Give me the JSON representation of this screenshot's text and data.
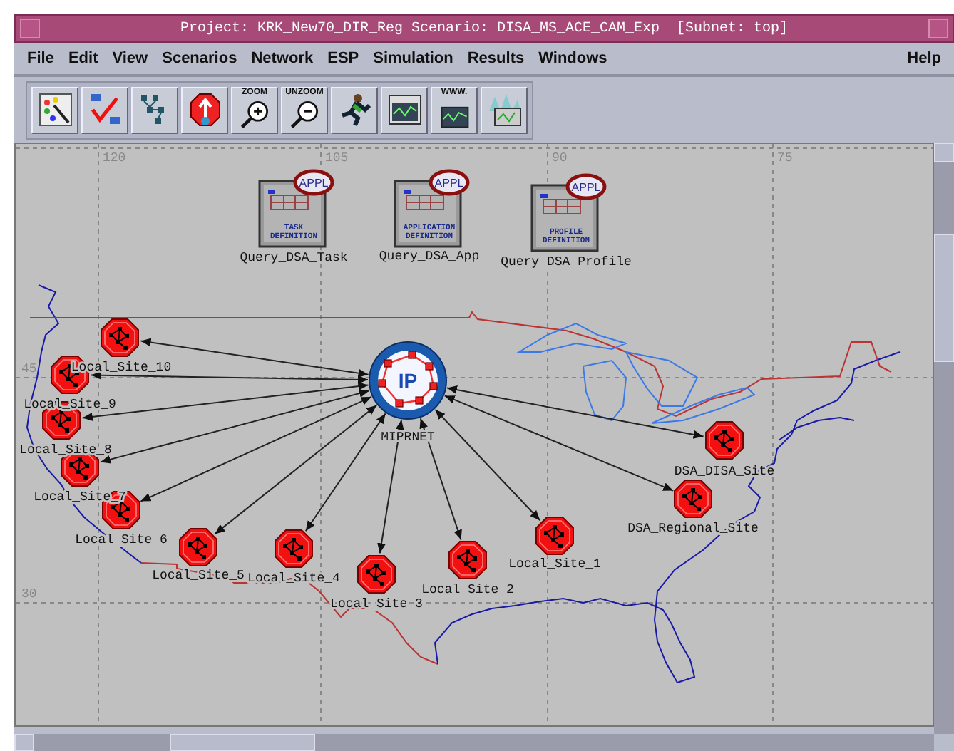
{
  "window": {
    "title": "Project: KRK_New70_DIR_Reg Scenario: DISA_MS_ACE_CAM_Exp  [Subnet: top]"
  },
  "menu": [
    "File",
    "Edit",
    "View",
    "Scenarios",
    "Network",
    "ESP",
    "Simulation",
    "Results",
    "Windows",
    "Help"
  ],
  "toolbar": [
    {
      "kind": "palette"
    },
    {
      "kind": "verify"
    },
    {
      "kind": "topology"
    },
    {
      "kind": "failure"
    },
    {
      "kind": "zoom",
      "label": "ZOOM"
    },
    {
      "kind": "unzoom",
      "label": "UNZOOM"
    },
    {
      "kind": "run"
    },
    {
      "kind": "graph"
    },
    {
      "kind": "web",
      "label": "WWW."
    },
    {
      "kind": "graphs"
    }
  ],
  "map": {
    "xticks": [
      "120",
      "105",
      "90",
      "75"
    ],
    "yticks": [
      "45",
      "30"
    ]
  },
  "nodes": [
    {
      "kind": "config",
      "label": "Query_DSA_Task",
      "badge": "APPL",
      "caption": [
        "TASK",
        "DEFINITION"
      ]
    },
    {
      "kind": "config",
      "label": "Query_DSA_App",
      "badge": "APPL",
      "caption": [
        "APPLICATION",
        "DEFINITION"
      ]
    },
    {
      "kind": "config",
      "label": "Query_DSA_Profile",
      "badge": "APPL",
      "caption": [
        "PROFILE",
        "DEFINITION"
      ]
    },
    {
      "kind": "hub",
      "label": "MIPRNET",
      "glyph": "IP"
    },
    {
      "kind": "site",
      "label": "Local_Site_10"
    },
    {
      "kind": "site",
      "label": "Local_Site_9"
    },
    {
      "kind": "site",
      "label": "Local_Site_8"
    },
    {
      "kind": "site",
      "label": "Local_Site_7"
    },
    {
      "kind": "site",
      "label": "Local_Site_6"
    },
    {
      "kind": "site",
      "label": "Local_Site_5"
    },
    {
      "kind": "site",
      "label": "Local_Site_4"
    },
    {
      "kind": "site",
      "label": "Local_Site_3"
    },
    {
      "kind": "site",
      "label": "Local_Site_2"
    },
    {
      "kind": "site",
      "label": "Local_Site_1"
    },
    {
      "kind": "site",
      "label": "DSA_DISA_Site"
    },
    {
      "kind": "site",
      "label": "DSA_Regional_Site"
    }
  ]
}
